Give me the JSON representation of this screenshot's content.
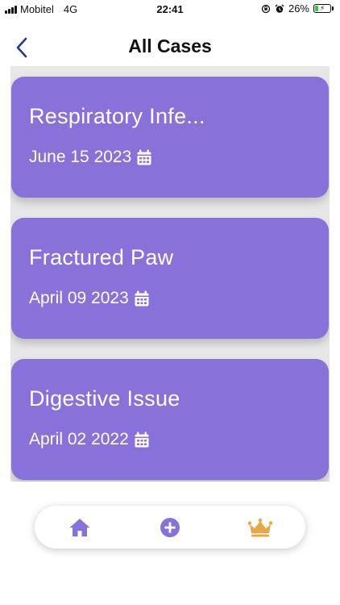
{
  "status_bar": {
    "carrier": "Mobitel",
    "network": "4G",
    "time": "22:41",
    "battery_percent": "26%",
    "battery_level": 0.26
  },
  "header": {
    "back_icon": "chevron-left-icon",
    "title": "All Cases"
  },
  "cases": [
    {
      "title": "Respiratory Infe...",
      "date": "June 15 2023"
    },
    {
      "title": "Fractured Paw",
      "date": "April 09 2023"
    },
    {
      "title": "Digestive Issue",
      "date": "April 02 2022"
    }
  ],
  "bottom_nav": {
    "items": [
      {
        "icon": "home-icon",
        "color": "#8672d9"
      },
      {
        "icon": "add-circle-icon",
        "color": "#8672d9"
      },
      {
        "icon": "crown-icon",
        "color": "#e8a645"
      }
    ]
  },
  "colors": {
    "card": "#8672d9",
    "accent": "#8672d9",
    "crown": "#e8a645",
    "back_arrow": "#1f3a93"
  }
}
